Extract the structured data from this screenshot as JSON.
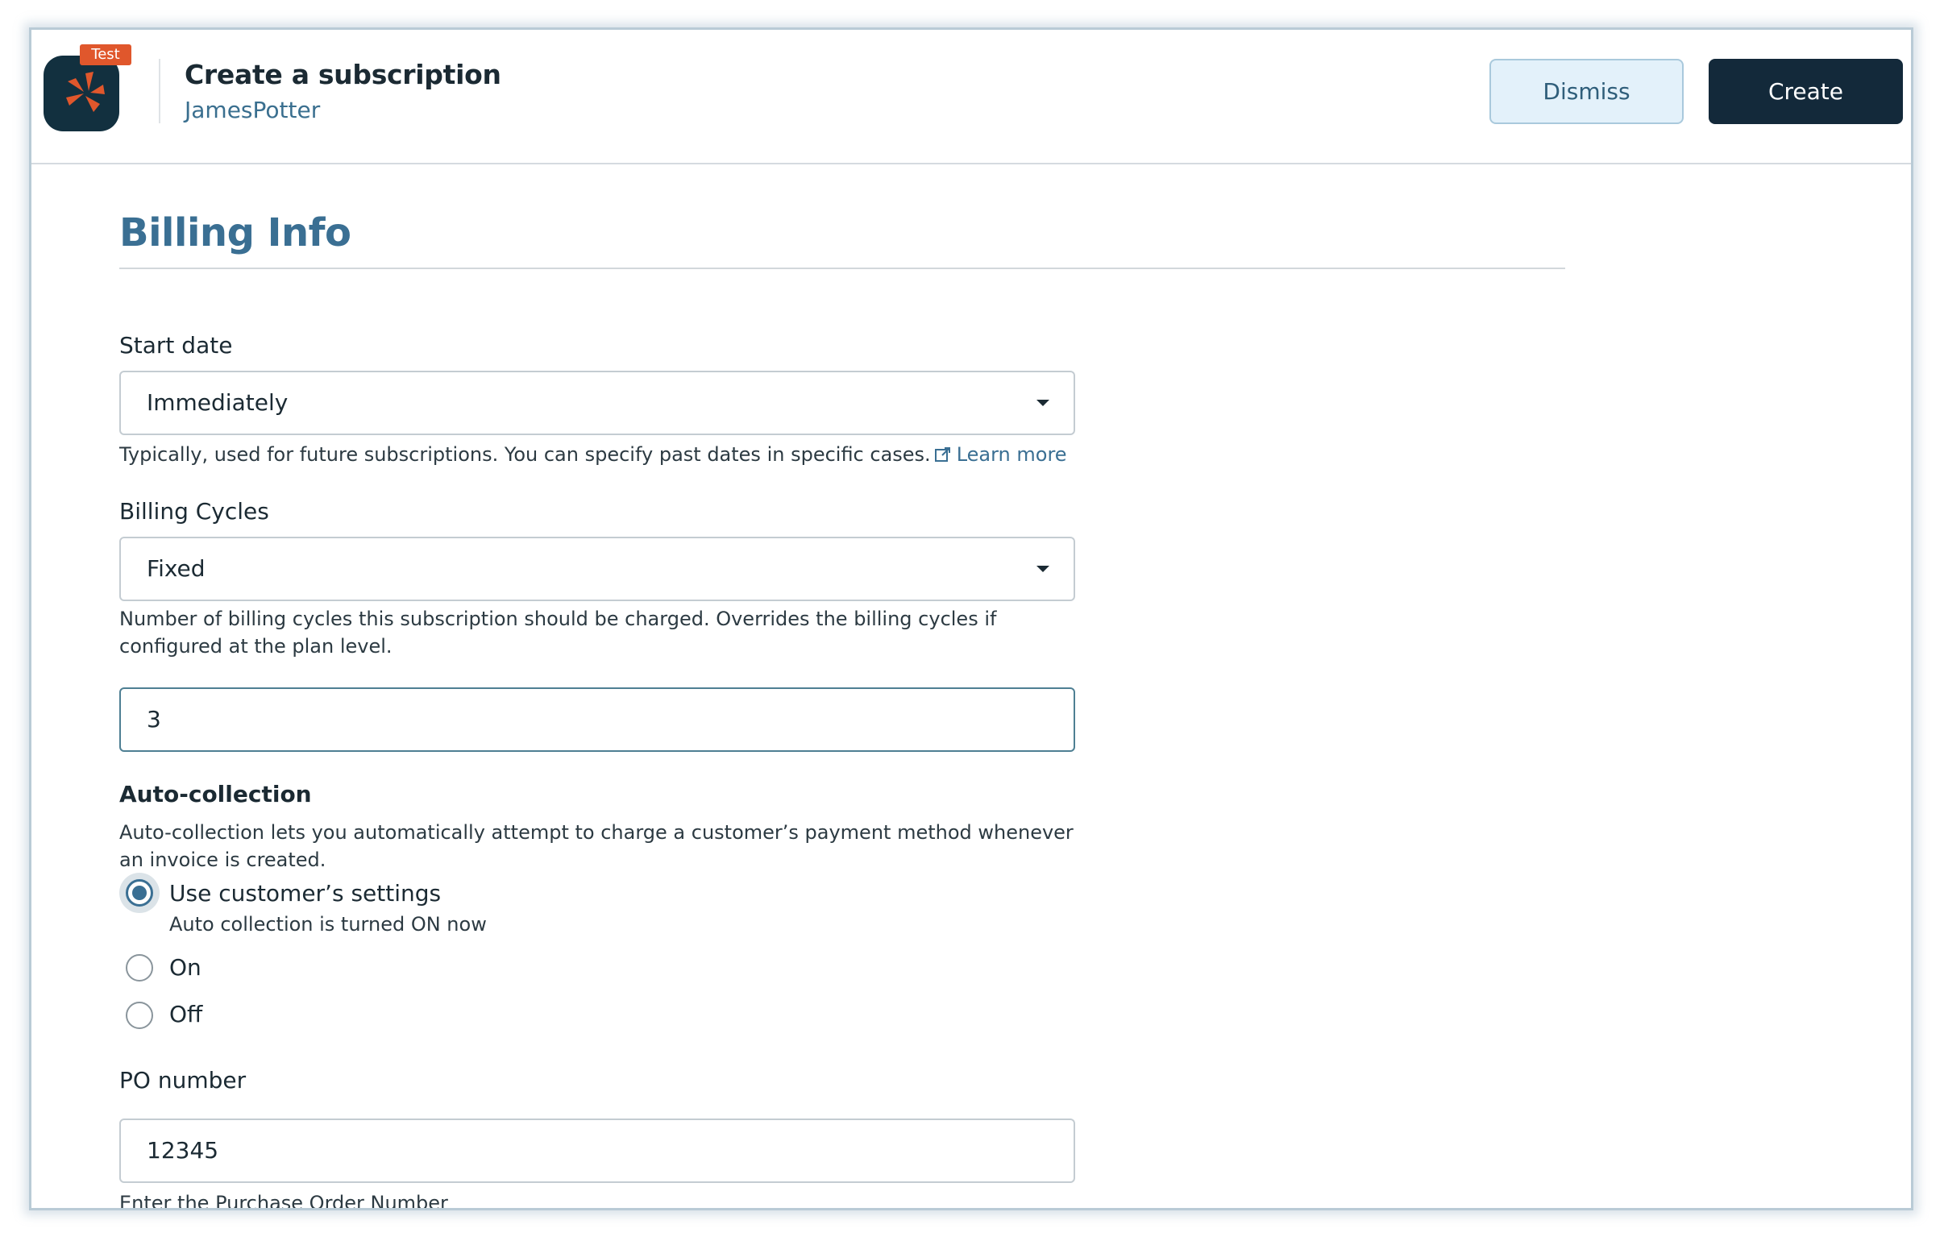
{
  "header": {
    "badge": "Test",
    "title": "Create a subscription",
    "customer": "JamesPotter",
    "dismiss_label": "Dismiss",
    "create_label": "Create"
  },
  "billing": {
    "section_title": "Billing Info",
    "start_date": {
      "label": "Start date",
      "value": "Immediately",
      "help": "Typically, used for future subscriptions. You can specify past dates in specific cases.",
      "link": "Learn more"
    },
    "billing_cycles": {
      "label": "Billing Cycles",
      "value": "Fixed",
      "help": "Number of billing cycles this subscription should be charged. Overrides the billing cycles if configured at the plan level.",
      "count": "3"
    },
    "auto_collection": {
      "label": "Auto-collection",
      "help": "Auto-collection lets you automatically attempt to charge a customer’s payment method whenever an invoice is created.",
      "options": [
        {
          "label": "Use customer’s settings",
          "sub": "Auto collection is turned ON now",
          "checked": true
        },
        {
          "label": "On",
          "checked": false
        },
        {
          "label": "Off",
          "checked": false
        }
      ]
    },
    "po_number": {
      "label": "PO number",
      "value": "12345",
      "help": "Enter the Purchase Order Number"
    }
  },
  "colors": {
    "accent": "#3a6f93",
    "primary_button": "#13293a",
    "badge": "#e0572c"
  }
}
